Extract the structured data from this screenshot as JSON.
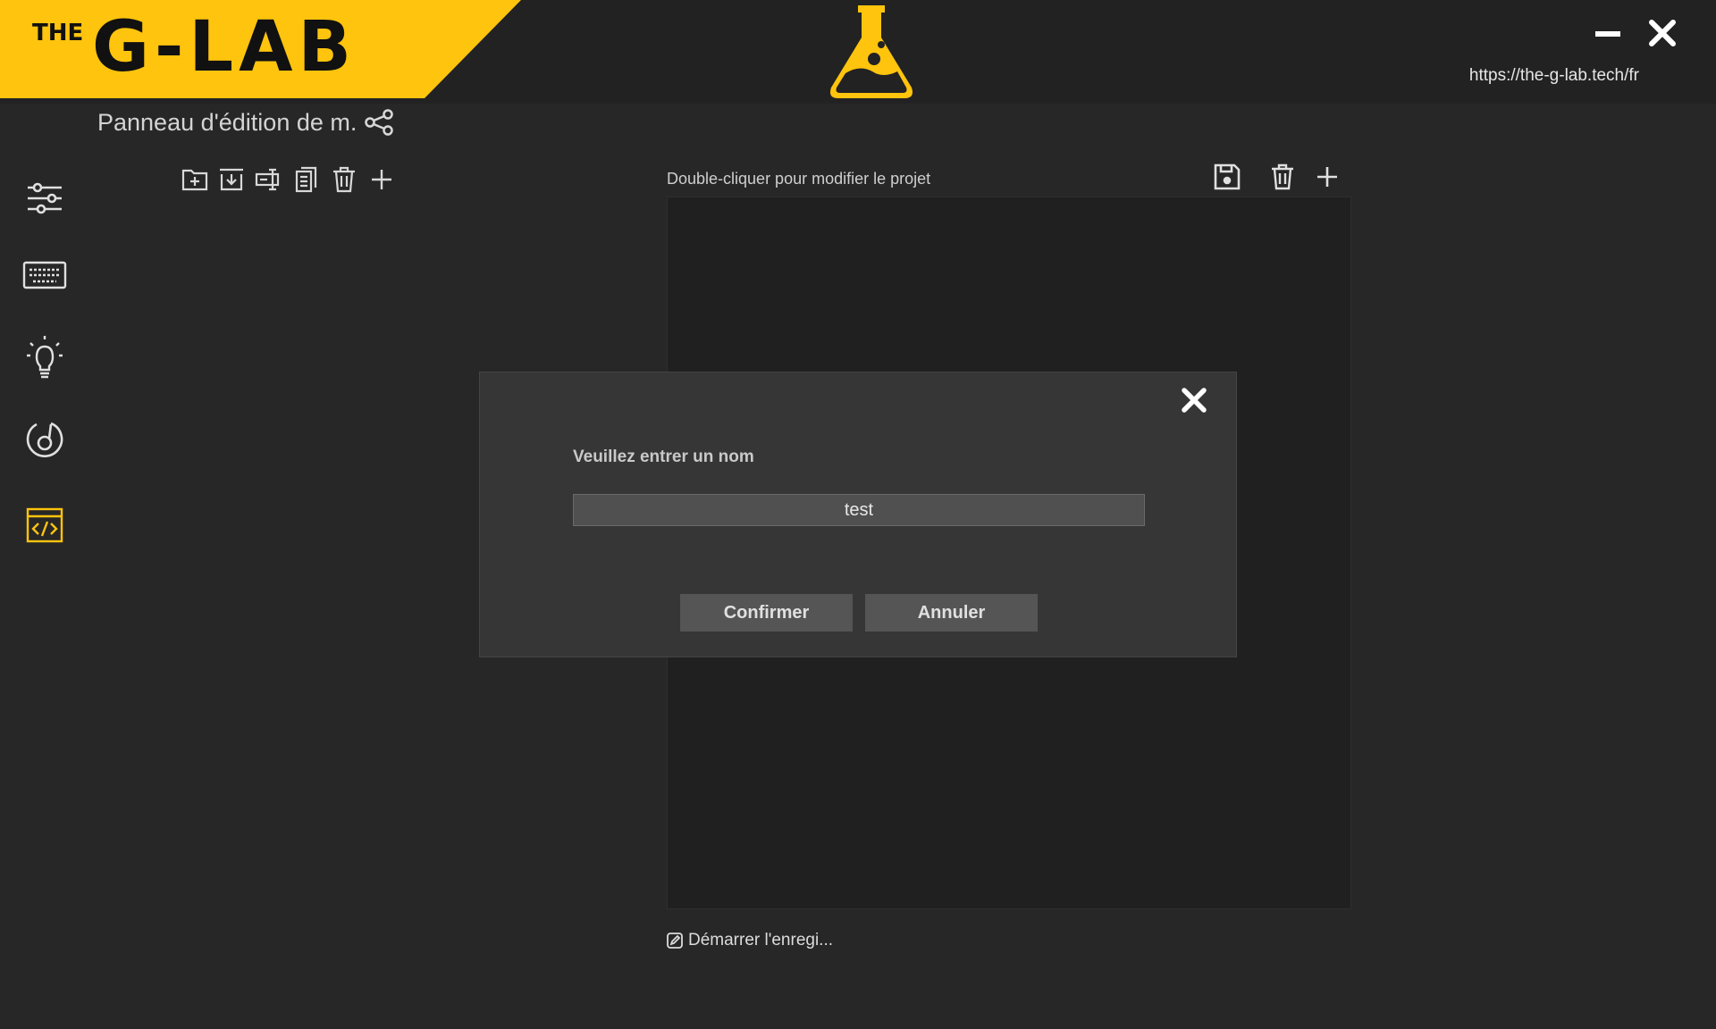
{
  "header": {
    "logo_prefix": "THE",
    "logo_main": "G-LAB",
    "url": "https://the-g-lab.tech/fr",
    "brand_color": "#FFC40D"
  },
  "panel": {
    "title": "Panneau d'édition de m."
  },
  "sidebar": {
    "items": [
      {
        "icon": "sliders-icon"
      },
      {
        "icon": "keyboard-icon"
      },
      {
        "icon": "lightbulb-icon"
      },
      {
        "icon": "performance-dial-icon"
      },
      {
        "icon": "code-window-icon",
        "active": true
      }
    ]
  },
  "macro_toolbar": {
    "icons": [
      "new-folder-icon",
      "import-icon",
      "rename-icon",
      "copy-icon",
      "delete-icon",
      "add-icon"
    ]
  },
  "editor": {
    "hint": "Double-cliquer pour modifier le projet",
    "record_label": "Démarrer l'enregi..."
  },
  "dialog": {
    "label": "Veuillez entrer un nom",
    "input_value": "test",
    "confirm_label": "Confirmer",
    "cancel_label": "Annuler"
  }
}
